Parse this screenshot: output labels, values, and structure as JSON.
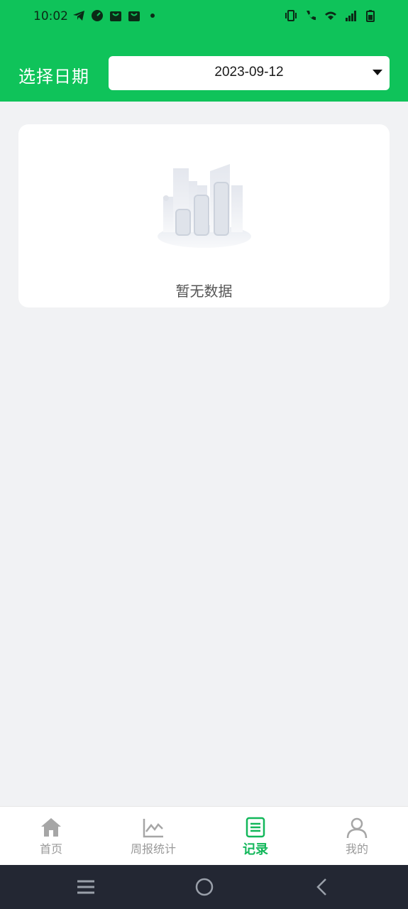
{
  "status_bar": {
    "time": "10:02",
    "left_icons": [
      "telegram-icon",
      "speedometer-icon",
      "shopping-bag-icon",
      "shopping-bag-icon",
      "dot-icon"
    ],
    "right_icons": [
      "vibrate-icon",
      "wifi-calling-icon",
      "wifi-icon",
      "signal-icon",
      "battery-icon"
    ]
  },
  "header": {
    "title": "选择日期",
    "date_value": "2023-09-12"
  },
  "empty_state": {
    "text": "暂无数据",
    "icon": "empty-buildings-illustration"
  },
  "tabs": [
    {
      "label": "首页",
      "icon": "home-icon",
      "active": false
    },
    {
      "label": "周报统计",
      "icon": "line-chart-icon",
      "active": false
    },
    {
      "label": "记录",
      "icon": "list-document-icon",
      "active": true
    },
    {
      "label": "我的",
      "icon": "user-icon",
      "active": false
    }
  ],
  "colors": {
    "brand": "#0fc35a",
    "active_tab": "#12b75a",
    "inactive_tab": "#9a9a9a",
    "background": "#f1f2f4",
    "nav_bar": "#232733"
  },
  "system_nav": [
    "menu-icon",
    "home-circle-icon",
    "back-icon"
  ]
}
